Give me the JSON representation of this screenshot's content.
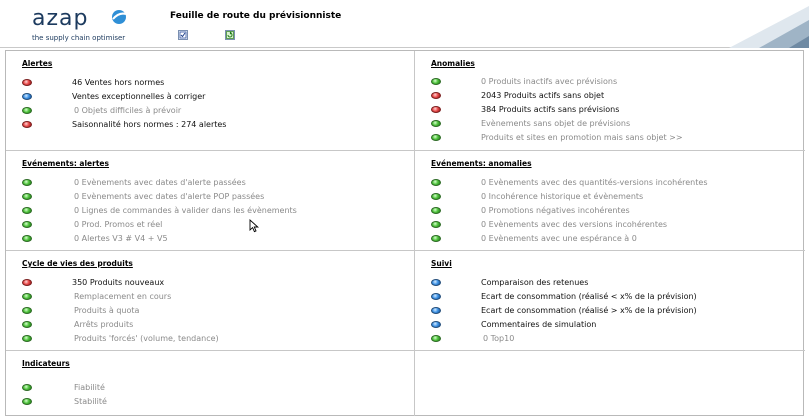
{
  "header": {
    "logo_text": "azap",
    "tagline": "the supply chain optimiser",
    "title": "Feuille de route du prévisionniste"
  },
  "colors": {
    "green": "#4fc23c",
    "red": "#e84a4a",
    "blue": "#3f93e6",
    "dim_text": "#8a8a8a"
  },
  "panels": {
    "alertes": {
      "title": "Alertes",
      "items": [
        {
          "status": "red",
          "label": "46 Ventes hors normes",
          "dim": false
        },
        {
          "status": "blue",
          "label": "Ventes exceptionnelles à corriger",
          "dim": false
        },
        {
          "status": "green",
          "label": "0 Objets difficiles à prévoir",
          "dim": true
        },
        {
          "status": "red",
          "label": "Saisonnalité hors normes : 274 alertes",
          "dim": false
        }
      ]
    },
    "anomalies": {
      "title": "Anomalies",
      "items": [
        {
          "status": "green",
          "label": "0 Produits inactifs avec prévisions",
          "dim": true
        },
        {
          "status": "red",
          "label": "2043 Produits actifs sans objet",
          "dim": false
        },
        {
          "status": "red",
          "label": "384 Produits actifs sans prévisions",
          "dim": false
        },
        {
          "status": "green",
          "label": "Evènements sans objet de prévisions",
          "dim": true
        },
        {
          "status": "green",
          "label": "Produits et sites en promotion mais sans objet  >>",
          "dim": true
        }
      ]
    },
    "evenements_alertes": {
      "title": "Evénements: alertes",
      "items": [
        {
          "status": "green",
          "label": "0 Evènements avec dates d'alerte passées",
          "dim": true
        },
        {
          "status": "green",
          "label": "0 Evènements avec dates d'alerte POP passées",
          "dim": true
        },
        {
          "status": "green",
          "label": "0 Lignes de commandes à valider dans les évènements",
          "dim": true
        },
        {
          "status": "green",
          "label": "0 Prod. Promos et réel",
          "dim": true
        },
        {
          "status": "green",
          "label": "0 Alertes V3 # V4 + V5",
          "dim": true
        }
      ]
    },
    "evenements_anomalies": {
      "title": "Evénements: anomalies",
      "items": [
        {
          "status": "green",
          "label": "0 Evènements avec des quantités-versions incohérentes",
          "dim": true
        },
        {
          "status": "green",
          "label": "0 Incohérence historique et évènements",
          "dim": true
        },
        {
          "status": "green",
          "label": "0 Promotions négatives incohérentes",
          "dim": true
        },
        {
          "status": "green",
          "label": "0 Evènements avec des versions incohérentes",
          "dim": true
        },
        {
          "status": "green",
          "label": "0 Evènements avec une espérance à 0",
          "dim": true
        }
      ]
    },
    "cycle": {
      "title": "Cycle de vies des produits",
      "items": [
        {
          "status": "red",
          "label": "350 Produits nouveaux",
          "dim": false
        },
        {
          "status": "green",
          "label": "Remplacement en cours",
          "dim": true
        },
        {
          "status": "green",
          "label": "Produits à quota",
          "dim": true
        },
        {
          "status": "green",
          "label": "Arrêts produits",
          "dim": true
        },
        {
          "status": "green",
          "label": "Produits 'forcés' (volume, tendance)",
          "dim": true
        }
      ]
    },
    "suivi": {
      "title": "Suivi",
      "items": [
        {
          "status": "blue",
          "label": "Comparaison des retenues",
          "dim": false
        },
        {
          "status": "blue",
          "label": "Ecart de consommation (réalisé < x% de la prévision)",
          "dim": false
        },
        {
          "status": "blue",
          "label": "Ecart de consommation (réalisé > x% de la prévision)",
          "dim": false
        },
        {
          "status": "blue",
          "label": "Commentaires de simulation",
          "dim": false
        },
        {
          "status": "green",
          "label": "0 Top10",
          "dim": true
        }
      ]
    },
    "indicateurs": {
      "title": "Indicateurs",
      "items": [
        {
          "status": "green",
          "label": "Fiabilité",
          "dim": true
        },
        {
          "status": "green",
          "label": "Stabilité",
          "dim": true
        }
      ]
    }
  }
}
